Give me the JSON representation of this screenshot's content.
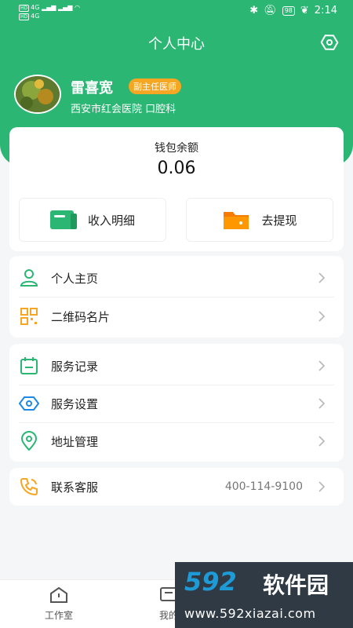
{
  "status_bar": {
    "left_badge_top": "HD",
    "left_badge_bottom": "HD",
    "left_network_top": "4G",
    "left_network_bottom": "4G",
    "battery": "98",
    "time": "2:14"
  },
  "header": {
    "title": "个人中心"
  },
  "profile": {
    "name": "雷喜宽",
    "rank": "副主任医师",
    "hospital": "西安市红会医院 口腔科"
  },
  "wallet": {
    "label": "钱包余额",
    "value": "0.06",
    "income_label": "收入明细",
    "withdraw_label": "去提现"
  },
  "menu_group_1": [
    {
      "label": "个人主页",
      "icon": "person-icon"
    },
    {
      "label": "二维码名片",
      "icon": "qrcode-icon"
    }
  ],
  "menu_group_2": [
    {
      "label": "服务记录",
      "icon": "calendar-icon"
    },
    {
      "label": "服务设置",
      "icon": "hexagon-settings-icon"
    },
    {
      "label": "地址管理",
      "icon": "location-icon"
    }
  ],
  "contact": {
    "label": "联系客服",
    "phone": "400-114-9100",
    "icon": "phone-icon"
  },
  "tabbar": {
    "tab1": "工作室",
    "tab2": "我的"
  },
  "watermark": {
    "logo": "592",
    "brand": "软件园",
    "url": "www.592xiazai.com"
  },
  "colors": {
    "primary": "#2bb673",
    "rank_badge": "#f5a623",
    "icon_orange": "#f5a623",
    "icon_green": "#2bb673",
    "icon_blue": "#1e88e5"
  }
}
